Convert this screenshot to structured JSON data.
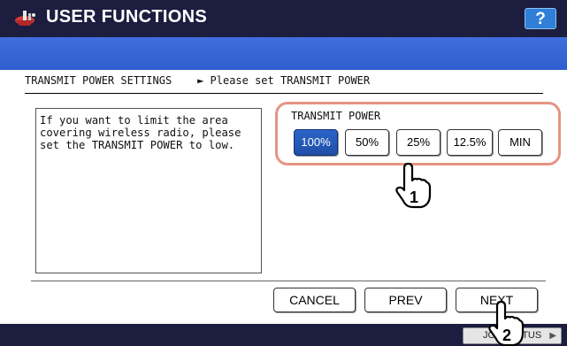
{
  "header": {
    "title": "USER FUNCTIONS",
    "help_label": "?"
  },
  "breadcrumb": {
    "text": "TRANSMIT POWER SETTINGS    ► Please set TRANSMIT POWER"
  },
  "info": {
    "text": "If you want to limit the area\ncovering wireless radio, please\nset the TRANSMIT POWER to low."
  },
  "power": {
    "label": "TRANSMIT POWER",
    "selected": "100%",
    "options": [
      "100%",
      "50%",
      "25%",
      "12.5%",
      "MIN"
    ]
  },
  "nav": {
    "cancel": "CANCEL",
    "prev": "PREV",
    "next": "NEXT"
  },
  "status": {
    "job_status": "JOB STATUS"
  },
  "callouts": [
    "1",
    "2"
  ],
  "colors": {
    "title_bar": "#1c1d3f",
    "band": "#3a69d8",
    "selected_button": "#2b65c8",
    "highlight_frame": "#e69484"
  }
}
